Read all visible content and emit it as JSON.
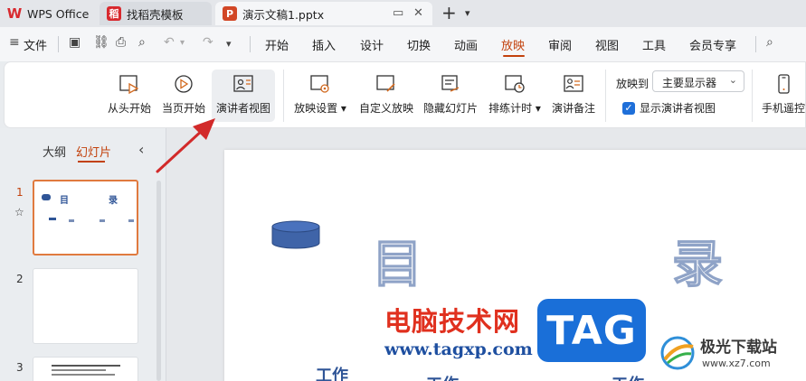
{
  "tabs": [
    {
      "label": "WPS Office",
      "icon": "W"
    },
    {
      "label": "找稻壳模板",
      "icon": "稻"
    },
    {
      "label": "演示文稿1.pptx",
      "icon": "P"
    }
  ],
  "menu": [
    "开始",
    "插入",
    "设计",
    "切换",
    "动画",
    "放映",
    "审阅",
    "视图",
    "工具",
    "会员专享"
  ],
  "menu_file": "文件",
  "active_menu": "放映",
  "ribbon": {
    "from_start": "从头开始",
    "from_current": "当页开始",
    "presenter_view": "演讲者视图",
    "show_settings": "放映设置",
    "custom_show": "自定义放映",
    "hide_slide": "隐藏幻灯片",
    "rehearse": "排练计时",
    "speaker_notes": "演讲备注",
    "show_on_label": "放映到",
    "show_on_value": "主要显示器",
    "show_presenter_label": "显示演讲者视图",
    "phone_remote": "手机遥控"
  },
  "left_panel": {
    "outline_tab": "大纲",
    "slides_tab": "幻灯片",
    "slides": [
      {
        "number": "1",
        "title_left": "目",
        "title_right": "录"
      },
      {
        "number": "2"
      },
      {
        "number": "3"
      }
    ]
  },
  "slide": {
    "title_left": "目",
    "title_right": "录",
    "items": [
      "工作",
      "工作",
      "工作"
    ]
  },
  "watermark": {
    "site_cn": "电脑技术网",
    "site_url": "www.tagxp.com",
    "tag": "TAG",
    "jg_name": "极光下载站",
    "jg_url": "www.xz7.com"
  },
  "colors": {
    "accent": "#c2410c",
    "slide_text": "#2f5597",
    "checkbox": "#1e6fd9",
    "annotation_arrow": "#d22a2a"
  }
}
